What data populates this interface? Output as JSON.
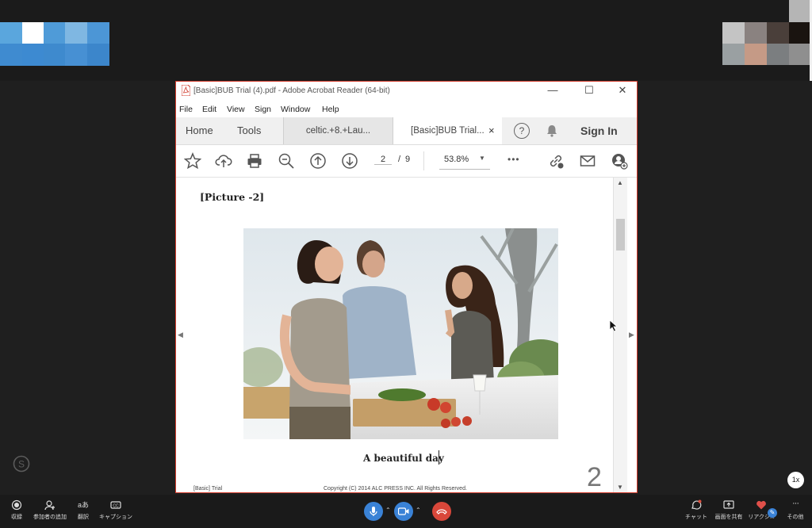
{
  "meeting": {
    "speed_badge": "1x",
    "left_tools": [
      {
        "icon": "record-icon",
        "label": "収録"
      },
      {
        "icon": "add-participant-icon",
        "label": "参加者の追加"
      },
      {
        "icon": "translate-icon",
        "label": "翻訳"
      },
      {
        "icon": "cc-icon",
        "label": "キャプション"
      }
    ],
    "right_tools": [
      {
        "icon": "chat-icon",
        "label": "チャット"
      },
      {
        "icon": "share-screen-icon",
        "label": "画面を共有"
      },
      {
        "icon": "heart-icon",
        "label": "リアクシ..."
      },
      {
        "icon": "more-icon",
        "label": "その他"
      }
    ],
    "colors": {
      "mic": "#3a82d6",
      "video": "#3a82d6",
      "hangup": "#d9473a"
    }
  },
  "acrobat": {
    "title": "[Basic]BUB Trial (4).pdf - Adobe Acrobat Reader (64-bit)",
    "menu": [
      "File",
      "Edit",
      "View",
      "Sign",
      "Window",
      "Help"
    ],
    "tabs": {
      "home": "Home",
      "tools": "Tools",
      "doc1": "celtic.+8.+Lau...",
      "doc2": "[Basic]BUB Trial...",
      "close": "×",
      "help": "?",
      "signin": "Sign In"
    },
    "toolbar": {
      "page_current": "2",
      "page_sep": "/",
      "page_total": "9",
      "zoom": "53.8%",
      "more": "•••"
    },
    "page": {
      "heading": "[Picture -2]",
      "caption": "A beautiful day",
      "page_number": "2",
      "footer_left": "[Basic] Trial",
      "footer_center": "Copyright (C) 2014 ALC PRESS INC. All Rights Reserved."
    }
  }
}
